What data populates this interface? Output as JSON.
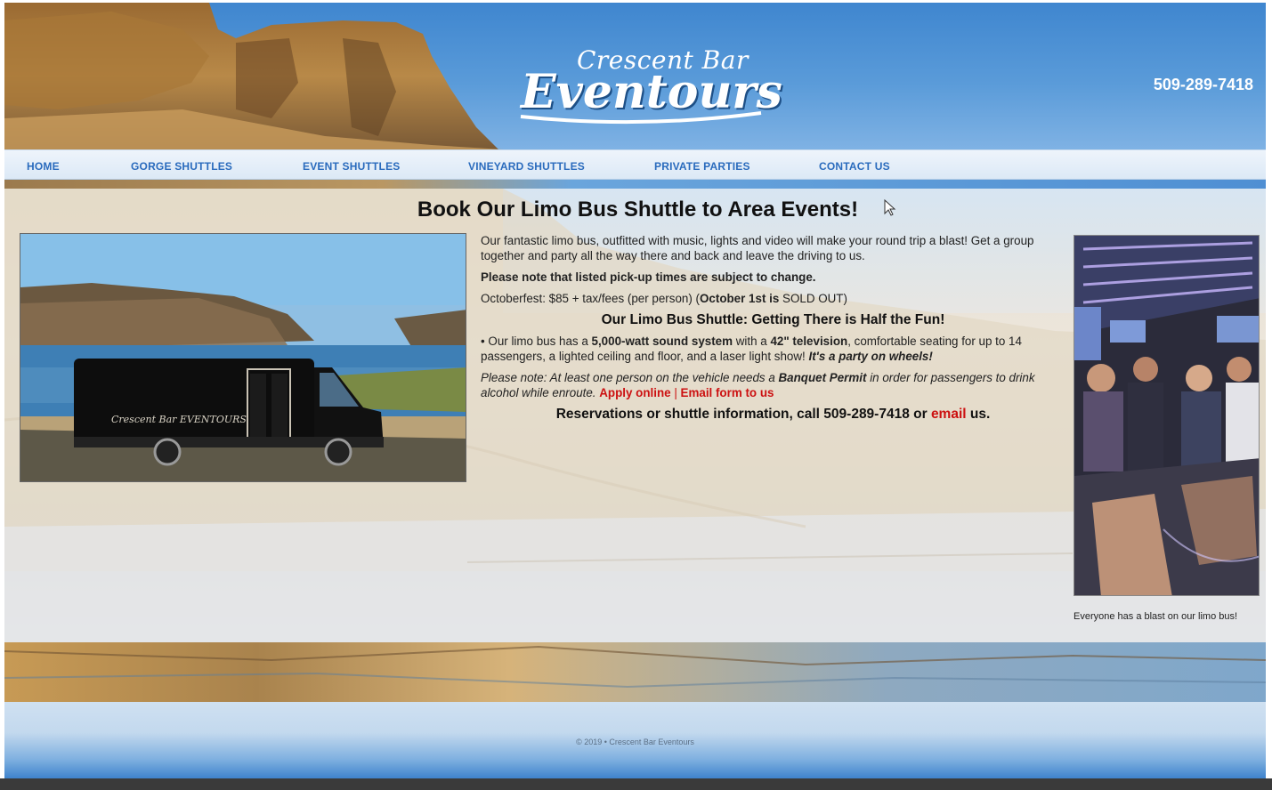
{
  "header": {
    "logo_line1": "Crescent Bar",
    "logo_line2": "Eventours",
    "phone": "509-289-7418"
  },
  "nav": {
    "items": [
      {
        "label": "HOME"
      },
      {
        "label": "GORGE SHUTTLES"
      },
      {
        "label": "EVENT SHUTTLES"
      },
      {
        "label": "VINEYARD SHUTTLES"
      },
      {
        "label": "PRIVATE PARTIES"
      },
      {
        "label": "CONTACT US"
      }
    ]
  },
  "main": {
    "headline": "Book Our Limo Bus Shuttle to Area Events!",
    "bus_lettering": "Crescent Bar EVENTOURS",
    "intro": "Our fantastic limo bus, outfitted with music, lights and video will make your round trip a blast! Get a group together and party all the way there and back and leave the driving to us.",
    "notice": "Please note that listed pick-up times are subject to change.",
    "event_price_text": "Octoberfest: $85 + tax/fees (per person)",
    "event_sold_open": " (",
    "event_sold_bold": "October 1st is",
    "event_sold_tail": " SOLD OUT)",
    "subheading": "Our Limo Bus Shuttle: Getting There is Half the Fun!",
    "features": {
      "prefix": "• Our limo bus has a ",
      "sound": "5,000-watt sound system",
      "mid1": " with a ",
      "tv": "42\" television",
      "mid2": ", comfortable seating for up to 14 passengers, a lighted ceiling and floor, and a laser light show! ",
      "party": "It's a party on wheels!"
    },
    "permit": {
      "prefix": "Please note: At least one person on the vehicle needs a ",
      "permit_name": "Banquet Permit",
      "suffix": " in order for passengers to drink alcohol while enroute. ",
      "apply_link": "Apply online",
      "separator": " | ",
      "email_form_link": "Email form to us"
    },
    "reservations": {
      "text": "Reservations or shuttle information, call 509-289-7418 or ",
      "email_link": "email",
      "tail": " us."
    },
    "photo_caption": "Everyone has a blast on our limo bus!"
  },
  "footer": {
    "copyright": "© 2019 • Crescent Bar Eventours"
  },
  "colors": {
    "nav_link": "#2a6bbd",
    "link_red": "#cc1111",
    "header_blue": "#3f86cf"
  }
}
